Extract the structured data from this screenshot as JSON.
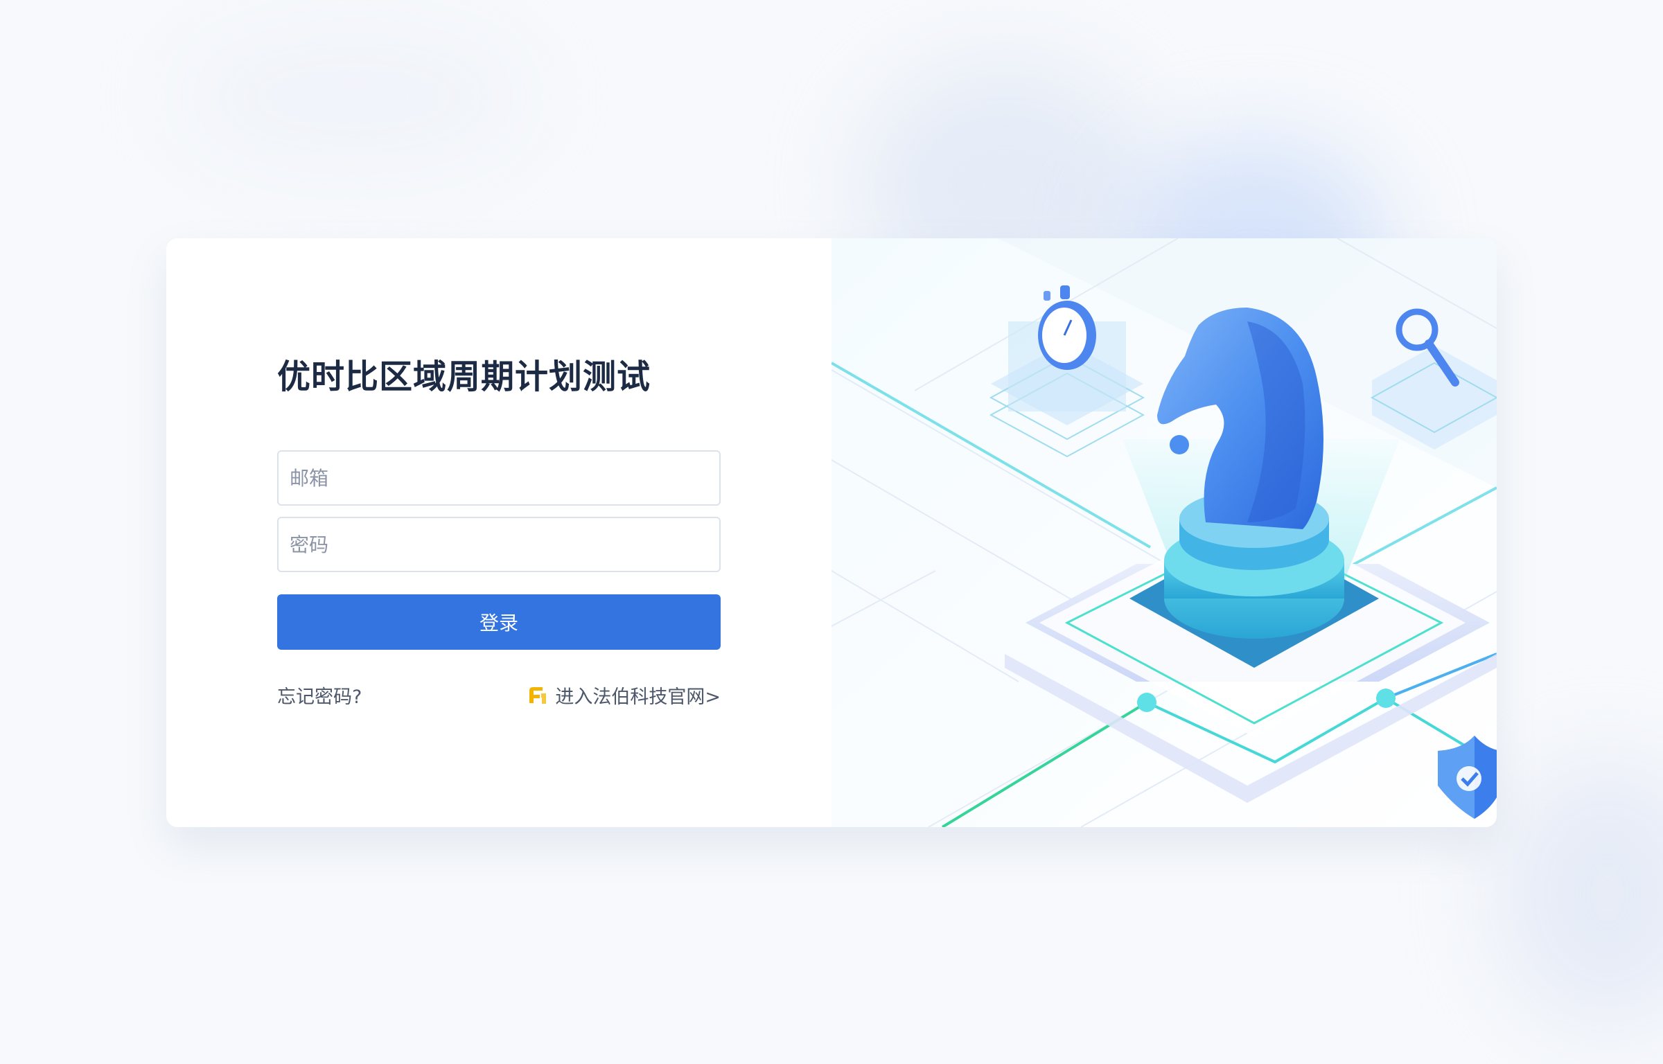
{
  "page": {
    "title": "优时比区域周期计划测试"
  },
  "form": {
    "email_placeholder": "邮箱",
    "password_placeholder": "密码",
    "login_label": "登录",
    "forgot_label": "忘记密码?",
    "site_link_label": "进入法伯科技官网>"
  },
  "illustration": {
    "items": [
      "chess-knight-icon",
      "stopwatch-icon",
      "magnifier-icon",
      "shield-check-icon"
    ]
  },
  "colors": {
    "accent": "#3474e0",
    "title": "#1c2a44",
    "link": "#4c576b",
    "logo": "#f2b400",
    "knight": "#3d86ee",
    "teal": "#4ad8d0"
  }
}
